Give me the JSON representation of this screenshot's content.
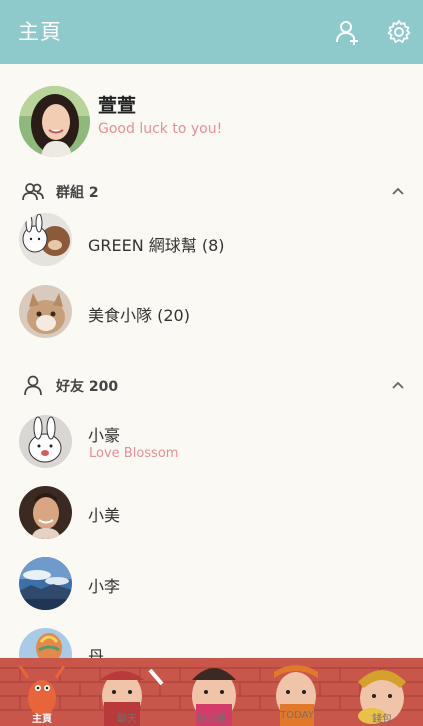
{
  "header": {
    "title": "主頁",
    "add_friend_icon": "add-user-icon",
    "settings_icon": "gear-icon"
  },
  "profile": {
    "name": "萱萱",
    "status": "Good luck to you!"
  },
  "groups": {
    "label": "群組 2",
    "items": [
      {
        "name": "GREEN 網球幫 (8)",
        "avatar": "bear-bunny-sticker"
      },
      {
        "name": "美食小隊 (20)",
        "avatar": "cat-photo"
      }
    ]
  },
  "friends": {
    "label": "好友 200",
    "items": [
      {
        "name": "小豪",
        "status": "Love Blossom",
        "avatar": "bunny-sticker"
      },
      {
        "name": "小美",
        "avatar": "woman-photo"
      },
      {
        "name": "小李",
        "avatar": "landscape-photo"
      },
      {
        "name": "丹",
        "avatar": "balloon-photo"
      }
    ]
  },
  "tabs": [
    {
      "label": "主頁",
      "active": true
    },
    {
      "label": "聊天",
      "active": false
    },
    {
      "label": "貼文串",
      "active": false
    },
    {
      "label": "TODAY",
      "active": false
    },
    {
      "label": "錢包",
      "active": false
    }
  ],
  "colors": {
    "header": "#8ec9cc",
    "background": "#fbf9f3",
    "status_text": "#e98e97",
    "banner_brick": "#c9564b"
  }
}
